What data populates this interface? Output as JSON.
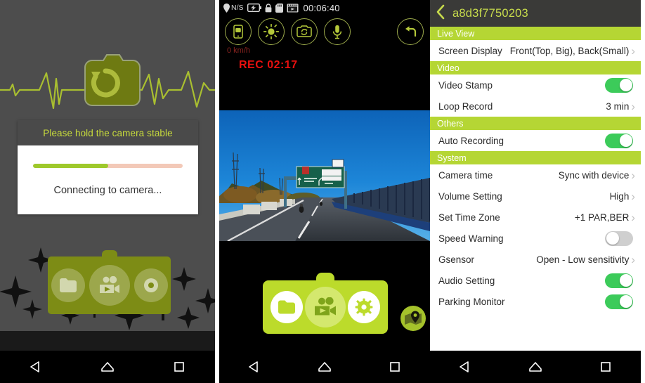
{
  "panel1": {
    "name": "connecting-screen",
    "logo_icon": "camera-refresh-icon",
    "ecg_icon": "heartbeat-line-icon",
    "dialog": {
      "title": "Please hold the camera stable",
      "status": "Connecting to camera...",
      "progress_percent": 50,
      "progress_fill_color": "#9ec92b",
      "progress_track_color": "#f3c9b8"
    },
    "menu_ghost": {
      "items": [
        {
          "icon": "folder-icon",
          "label": "Files"
        },
        {
          "icon": "video-camera-icon",
          "label": "Live View"
        },
        {
          "icon": "gear-icon",
          "label": "Settings"
        }
      ]
    },
    "background_color": "#4d4d4d",
    "accent_color": "#c8dc3c"
  },
  "panel2": {
    "name": "live-view-screen",
    "statusbar": {
      "gps_icon": "location-pin-icon",
      "gps_label": "N/S",
      "battery_icon": "battery-charging-icon",
      "lock_icon": "lock-icon",
      "sdcard_icon": "sd-card-icon",
      "video_icon": "film-strip-icon",
      "time": "00:06:40"
    },
    "tools": [
      {
        "icon": "snapshot-to-phone-icon",
        "label": "Snapshot"
      },
      {
        "icon": "brightness-icon",
        "label": "Brightness"
      },
      {
        "icon": "camera-switch-icon",
        "label": "Switch Camera"
      },
      {
        "icon": "microphone-icon",
        "label": "Microphone"
      }
    ],
    "back_button": {
      "icon": "back-arrow-icon",
      "label": "Back"
    },
    "speed": "0 km/h",
    "recording": "REC 02:17",
    "recording_color": "#e8100f",
    "speed_color": "#8b2420",
    "menu": {
      "items": [
        {
          "icon": "folder-icon",
          "label": "Files"
        },
        {
          "icon": "video-camera-icon",
          "label": "Live View"
        },
        {
          "icon": "gear-icon",
          "label": "Settings"
        }
      ],
      "expand_icon": "chevron-up-icon",
      "bg_color": "#bcdb2b"
    },
    "gps_button": {
      "icon": "map-pin-icon",
      "label": "Map"
    }
  },
  "panel3": {
    "name": "settings-screen",
    "header": {
      "back_icon": "chevron-left-icon",
      "title": "a8d3f7750203"
    },
    "sections": [
      {
        "title": "Live View",
        "rows": [
          {
            "label": "Screen Display",
            "type": "value",
            "value": "Front(Top, Big), Back(Small)",
            "chevron": "›"
          }
        ]
      },
      {
        "title": "Video",
        "rows": [
          {
            "label": "Video Stamp",
            "type": "toggle",
            "state": "on"
          },
          {
            "label": "Loop Record",
            "type": "value",
            "value": "3 min",
            "chevron": "›"
          }
        ]
      },
      {
        "title": "Others",
        "rows": [
          {
            "label": "Auto Recording",
            "type": "toggle",
            "state": "on"
          }
        ]
      },
      {
        "title": "System",
        "rows": [
          {
            "label": "Camera time",
            "type": "value",
            "value": "Sync with device",
            "chevron": "›"
          },
          {
            "label": "Volume Setting",
            "type": "value",
            "value": "High",
            "chevron": "›"
          },
          {
            "label": "Set Time Zone",
            "type": "value",
            "value": "+1 PAR,BER",
            "chevron": "›"
          },
          {
            "label": "Speed Warning",
            "type": "toggle",
            "state": "off"
          },
          {
            "label": "Gsensor",
            "type": "value",
            "value": "Open - Low sensitivity",
            "chevron": "›"
          },
          {
            "label": "Audio Setting",
            "type": "toggle",
            "state": "on"
          },
          {
            "label": "Parking Monitor",
            "type": "toggle",
            "state": "on"
          }
        ]
      }
    ],
    "section_bg_color": "#b5d634",
    "toggle_on_color": "#3ccb5a",
    "toggle_off_color": "#cfcfcf"
  },
  "navbar": {
    "back": {
      "icon": "triangle-back-icon",
      "label": "Back"
    },
    "home": {
      "icon": "home-icon",
      "label": "Home"
    },
    "recents": {
      "icon": "square-recents-icon",
      "label": "Recents"
    }
  }
}
